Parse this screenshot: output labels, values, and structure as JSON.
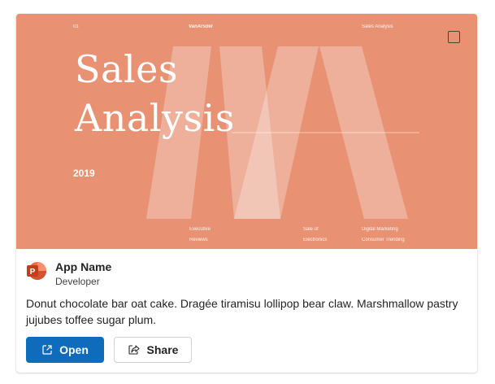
{
  "colors": {
    "slide_background": "#e89273",
    "accent": "#0f6cbd",
    "icon_orange": "#c43e1c"
  },
  "slide": {
    "page_number": "01",
    "brand": "VanArsdel",
    "header_right": "Sales Analysis",
    "title_line1": "Sales",
    "title_line2": "Analysis",
    "year": "2019",
    "footer": {
      "col1_line1": "Executive",
      "col1_line2": "Reviews",
      "col2_line1": "Sale of",
      "col2_line2": "Electronics",
      "col3_line1": "Digital Marketing",
      "col3_line2": "Consumer Trending"
    }
  },
  "app": {
    "icon": "powerpoint-icon",
    "name": "App Name",
    "developer": "Developer",
    "description": "Donut chocolate bar oat cake. Dragée tiramisu lollipop bear claw. Marshmallow pastry jujubes toffee sugar plum."
  },
  "actions": {
    "open_label": "Open",
    "open_icon": "open-external-icon",
    "share_label": "Share",
    "share_icon": "share-icon"
  }
}
